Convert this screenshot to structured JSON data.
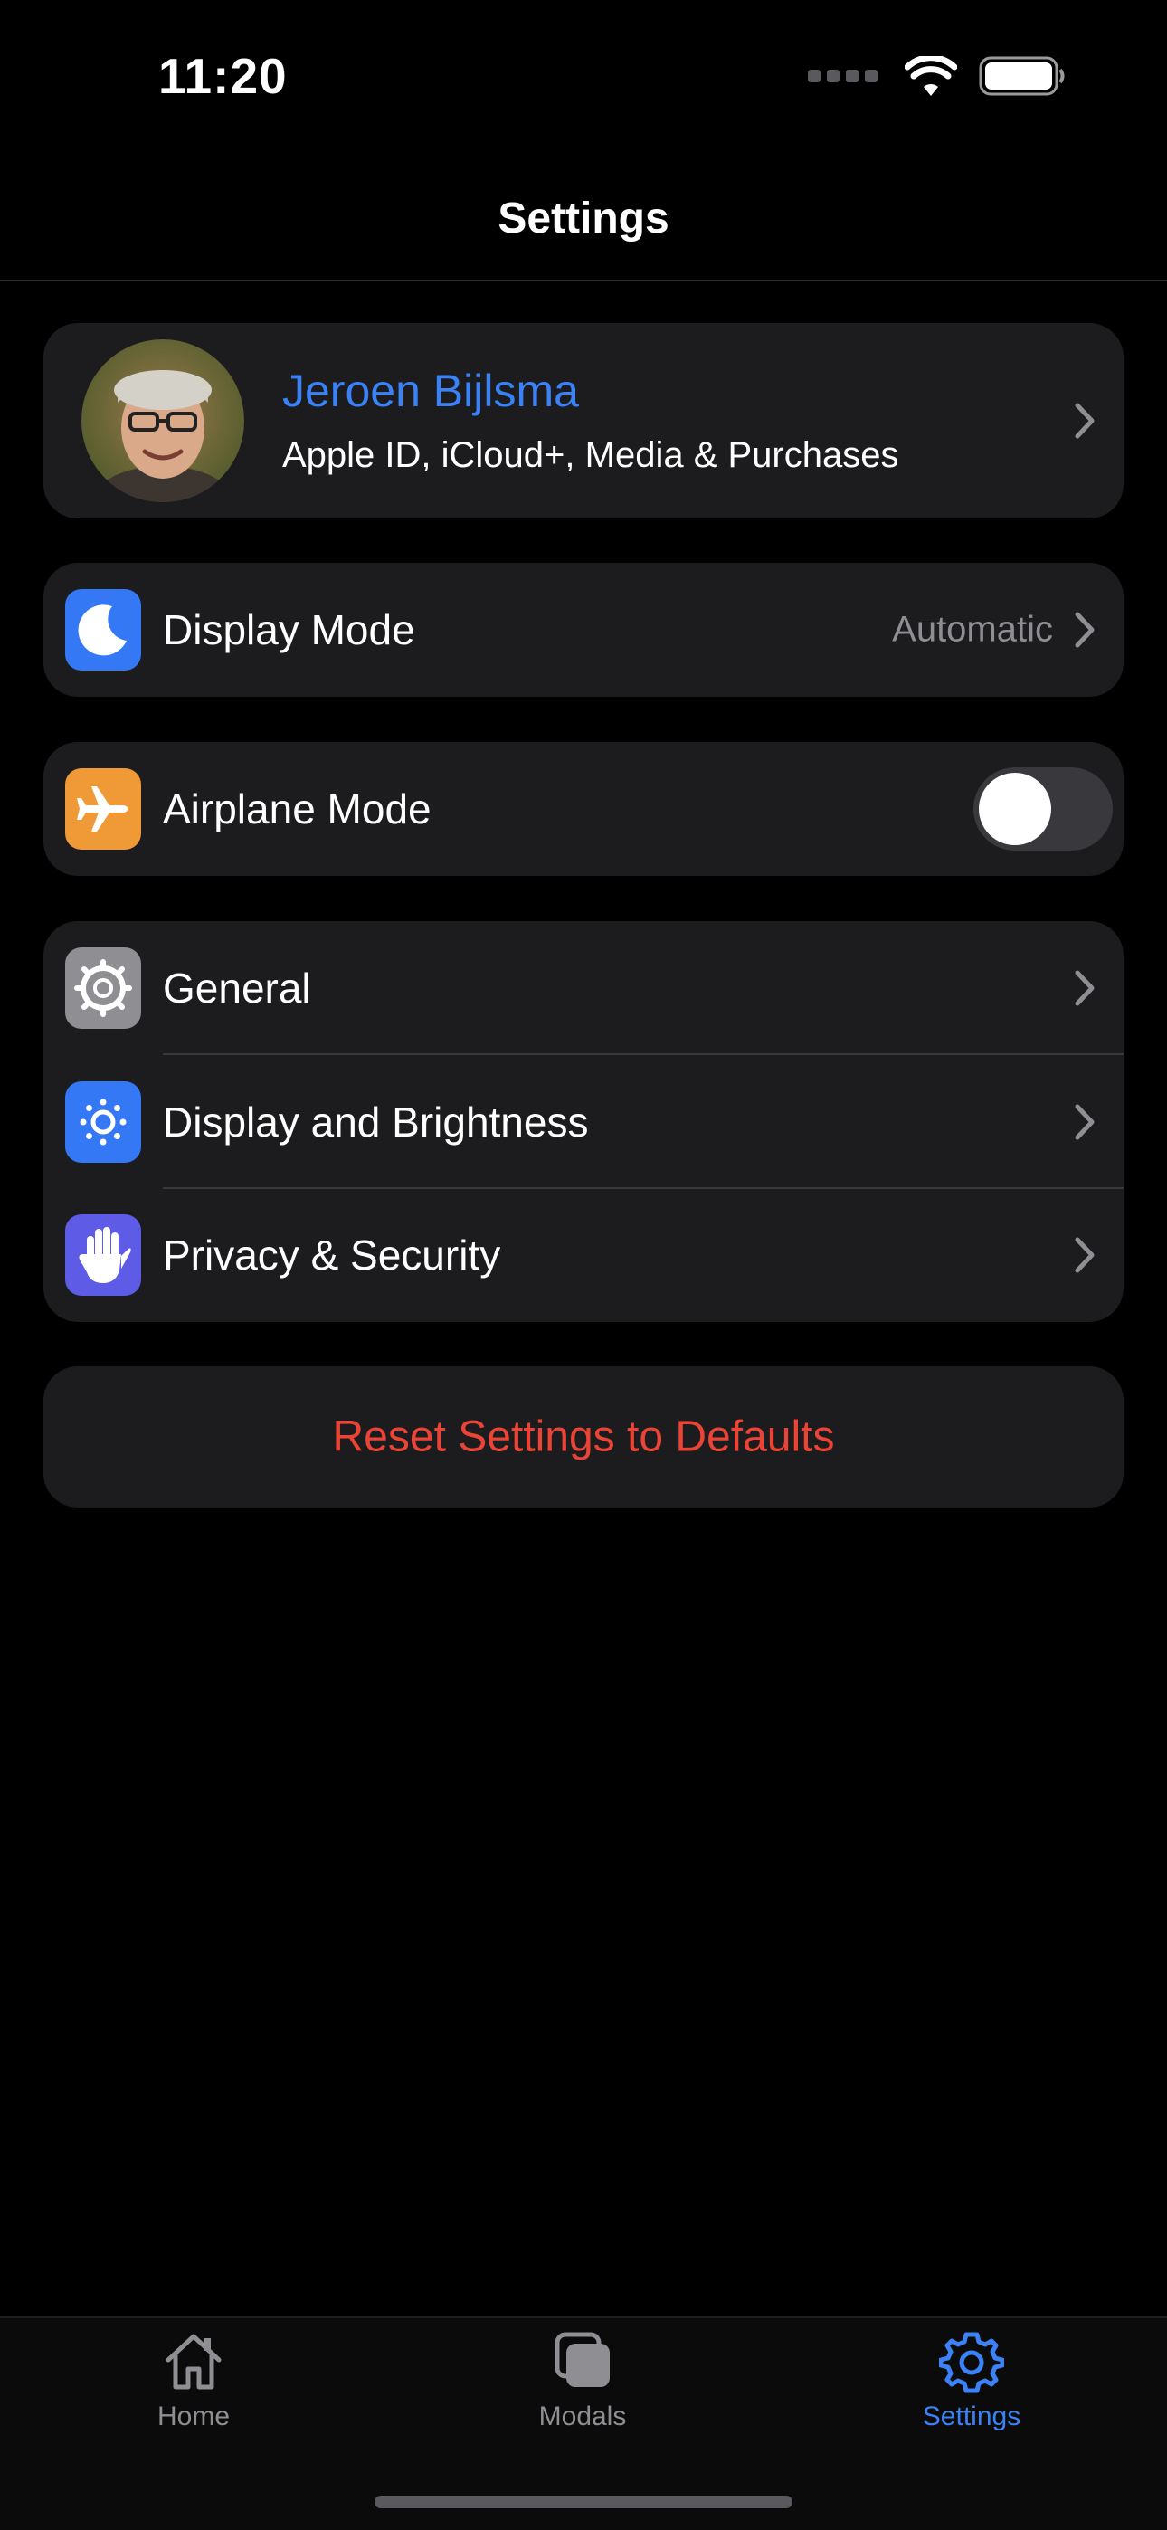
{
  "status_bar": {
    "time": "11:20"
  },
  "nav": {
    "title": "Settings"
  },
  "profile": {
    "name": "Jeroen Bijlsma",
    "subtitle": "Apple ID, iCloud+, Media & Purchases"
  },
  "display_mode": {
    "label": "Display Mode",
    "value": "Automatic",
    "icon": "moon-icon",
    "icon_color": "#3478f6"
  },
  "airplane_mode": {
    "label": "Airplane Mode",
    "enabled": false,
    "icon": "airplane-icon",
    "icon_color": "#f09a37"
  },
  "general_group": {
    "items": [
      {
        "label": "General",
        "icon": "gear-icon",
        "icon_color": "#8e8e93"
      },
      {
        "label": "Display and Brightness",
        "icon": "sun-icon",
        "icon_color": "#3478f6"
      },
      {
        "label": "Privacy & Security",
        "icon": "hand-icon",
        "icon_color": "#5e5ce6"
      }
    ]
  },
  "reset": {
    "label": "Reset Settings to Defaults",
    "color": "#eb4436"
  },
  "tab_bar": {
    "tabs": [
      {
        "label": "Home",
        "icon": "house-icon",
        "selected": false
      },
      {
        "label": "Modals",
        "icon": "stacked-squares-icon",
        "selected": false
      },
      {
        "label": "Settings",
        "icon": "gear-icon",
        "selected": true
      }
    ],
    "accent": "#3b82f6"
  }
}
